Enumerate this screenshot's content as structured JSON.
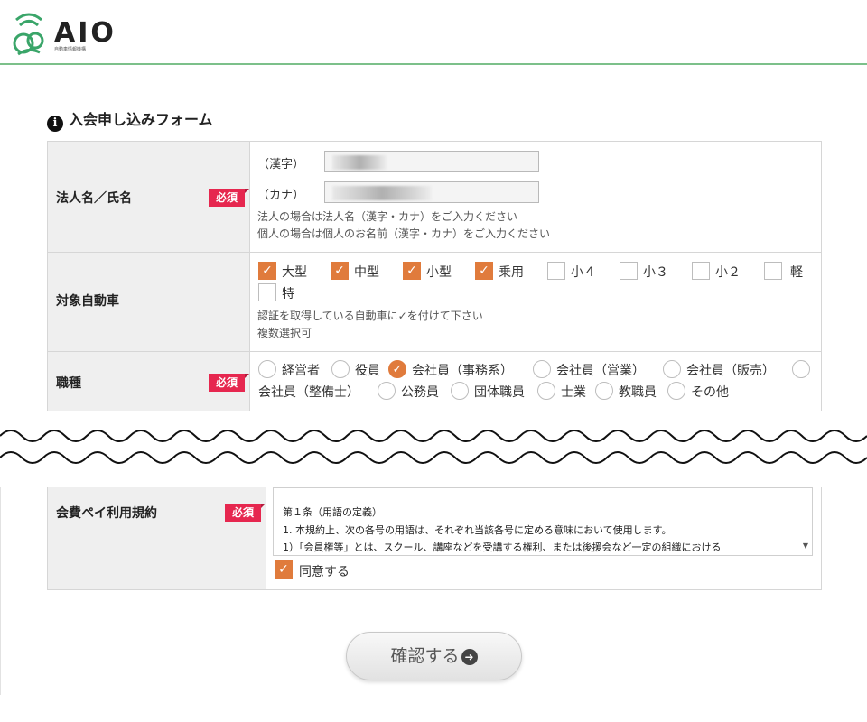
{
  "header": {
    "logo_text": "AIO",
    "logo_sub": "自動車情報機構"
  },
  "form": {
    "title": "入会申し込みフォーム",
    "required_label": "必須",
    "name_row": {
      "label": "法人名／氏名",
      "kanji_label": "（漢字）",
      "kana_label": "（カナ）",
      "note1": "法人の場合は法人名（漢字・カナ）をご入力ください",
      "note2": "個人の場合は個人のお名前（漢字・カナ）をご入力ください"
    },
    "vehicle_row": {
      "label": "対象自動車",
      "options": [
        {
          "label": "大型",
          "checked": true
        },
        {
          "label": "中型",
          "checked": true
        },
        {
          "label": "小型",
          "checked": true
        },
        {
          "label": "乗用",
          "checked": true
        },
        {
          "label": "小４",
          "checked": false
        },
        {
          "label": "小３",
          "checked": false
        },
        {
          "label": "小２",
          "checked": false
        },
        {
          "label": "軽",
          "checked": false
        },
        {
          "label": "特",
          "checked": false
        }
      ],
      "note1": "認証を取得している自動車に✓を付けて下さい",
      "note2": "複数選択可"
    },
    "job_row": {
      "label": "職種",
      "options": [
        {
          "label": "経営者",
          "checked": false
        },
        {
          "label": "役員",
          "checked": false
        },
        {
          "label": "会社員（事務系）",
          "checked": true
        },
        {
          "label": "会社員（営業）",
          "checked": false
        },
        {
          "label": "会社員（販売）",
          "checked": false
        },
        {
          "label": "会社員（整備士）",
          "checked": false
        },
        {
          "label": "公務員",
          "checked": false
        },
        {
          "label": "団体職員",
          "checked": false
        },
        {
          "label": "士業",
          "checked": false
        },
        {
          "label": "教職員",
          "checked": false
        },
        {
          "label": "その他",
          "checked": false
        }
      ]
    },
    "terms_row": {
      "label": "会費ペイ利用規約",
      "lines": [
        "第１条（用語の定義）",
        "1. 本規約上、次の各号の用語は、それぞれ当該各号に定める意味において使用します。",
        "1）「会員権等」とは、スクール、講座などを受講する権利、または後援会など一定の組織における"
      ],
      "agree_label": "同意する",
      "agree_checked": true
    },
    "submit_label": "確認する"
  },
  "colors": {
    "accent": "#e07b3c",
    "required": "#e6274f",
    "header_line": "#7cc08a"
  }
}
